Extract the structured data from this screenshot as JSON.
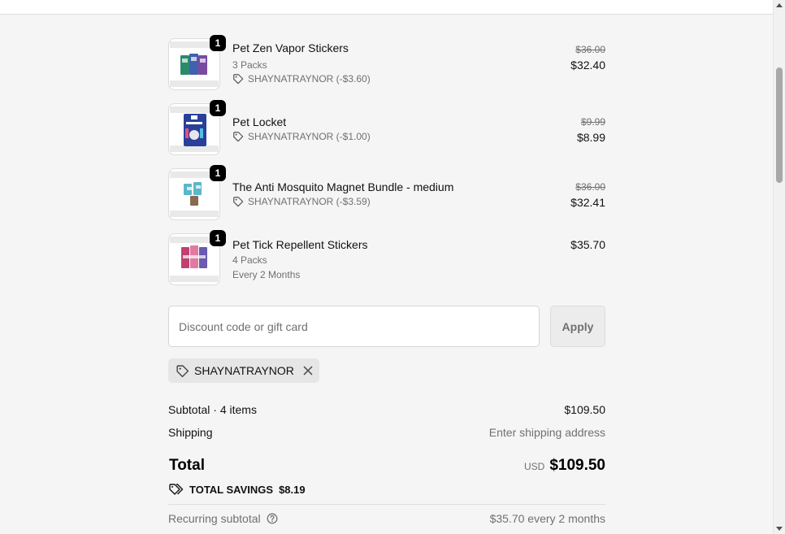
{
  "order_summary": {
    "items": [
      {
        "name": "Pet Zen Vapor Stickers",
        "quantity": "1",
        "variant": "3 Packs",
        "discount": "SHAYNATRAYNOR (-$3.60)",
        "original_price": "$36.00",
        "price": "$32.40",
        "thumb_icon": "sticker-packs-image",
        "thumb_colors": [
          "#2a8a6a",
          "#4060b0",
          "#7a4aa0"
        ]
      },
      {
        "name": "Pet Locket",
        "quantity": "1",
        "discount": "SHAYNATRAYNOR (-$1.00)",
        "original_price": "$9.99",
        "price": "$8.99",
        "thumb_icon": "locket-box-image",
        "thumb_colors": [
          "#2a3f9a",
          "#ffffff",
          "#e05080"
        ]
      },
      {
        "name": "The Anti Mosquito Magnet Bundle - medium",
        "quantity": "1",
        "discount": "SHAYNATRAYNOR (-$3.59)",
        "original_price": "$36.00",
        "price": "$32.41",
        "thumb_icon": "magnet-bundle-image",
        "thumb_colors": [
          "#5ab8c8",
          "#8a6a50",
          "#e0e8f0"
        ]
      },
      {
        "name": "Pet Tick Repellent Stickers",
        "quantity": "1",
        "variant": "4 Packs",
        "frequency": "Every 2 Months",
        "price": "$35.70",
        "thumb_icon": "tick-sticker-packs-image",
        "thumb_colors": [
          "#c04070",
          "#e07aa0",
          "#6a5ab0"
        ]
      }
    ],
    "discount_field": {
      "placeholder": "Discount code or gift card",
      "apply_label": "Apply"
    },
    "applied_code": "SHAYNATRAYNOR",
    "subtotal": {
      "label": "Subtotal · 4 items",
      "value": "$109.50"
    },
    "shipping": {
      "label": "Shipping",
      "value": "Enter shipping address"
    },
    "total": {
      "label": "Total",
      "currency": "USD",
      "value": "$109.50"
    },
    "savings": {
      "label": "TOTAL SAVINGS",
      "value": "$8.19"
    },
    "recurring": {
      "label": "Recurring subtotal",
      "value": "$35.70 every 2 months"
    }
  },
  "colors": {
    "background": "#f5f5f5",
    "muted_text": "#707070",
    "badge": "#000000"
  }
}
